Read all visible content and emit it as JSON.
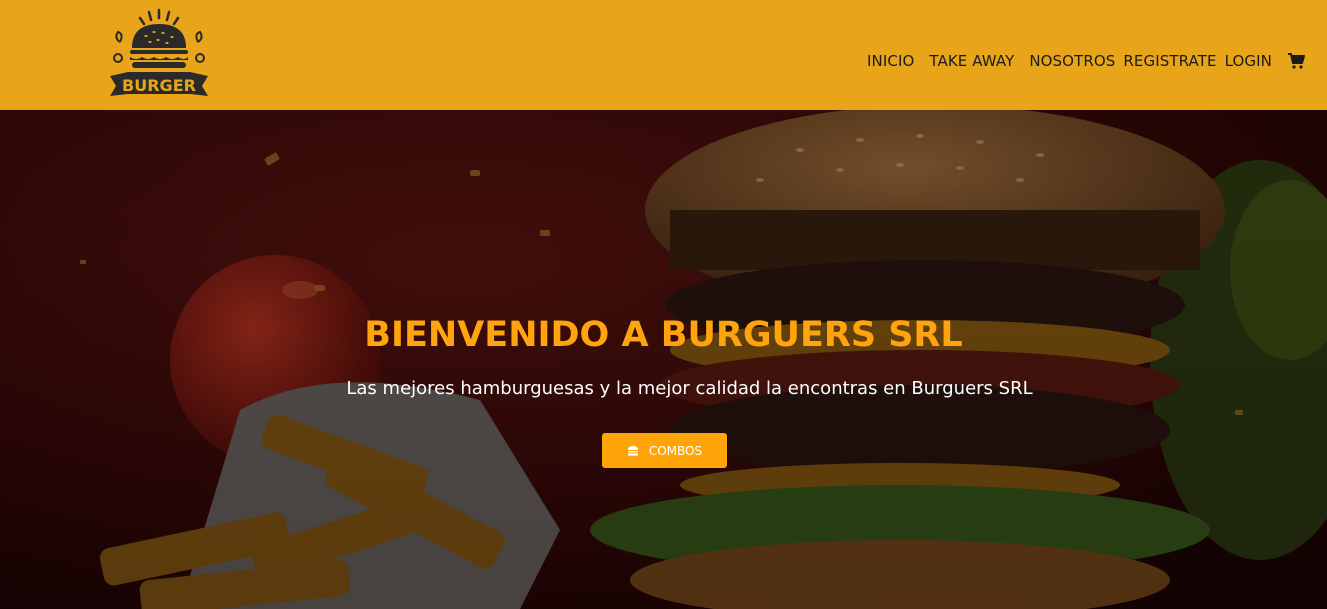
{
  "brand": {
    "logo_text": "BURGER",
    "primary_color": "#e9a519",
    "accent_color": "#ffa40e"
  },
  "nav": {
    "items": [
      {
        "label": "INICIO"
      },
      {
        "label": "TAKE AWAY"
      },
      {
        "label": "NOSOTROS"
      },
      {
        "label": "REGISTRATE"
      },
      {
        "label": "LOGIN"
      }
    ],
    "cart_icon": "shopping-cart-icon"
  },
  "hero": {
    "title": "BIENVENIDO A BURGUERS SRL",
    "subtitle": "Las mejores hamburguesas y la mejor calidad la encontras en Burguers SRL",
    "button": {
      "label": "COMBOS",
      "icon": "burger-icon"
    }
  }
}
